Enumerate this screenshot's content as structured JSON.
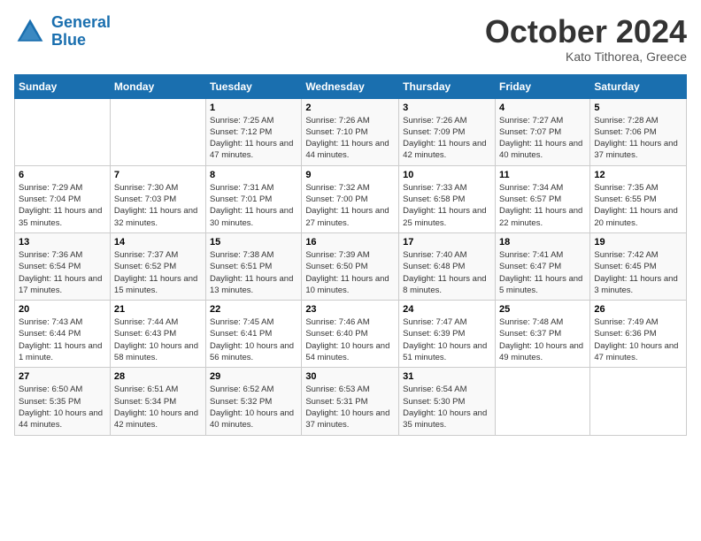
{
  "header": {
    "logo_line1": "General",
    "logo_line2": "Blue",
    "month": "October 2024",
    "location": "Kato Tithorea, Greece"
  },
  "days_of_week": [
    "Sunday",
    "Monday",
    "Tuesday",
    "Wednesday",
    "Thursday",
    "Friday",
    "Saturday"
  ],
  "weeks": [
    [
      {
        "day": "",
        "info": ""
      },
      {
        "day": "",
        "info": ""
      },
      {
        "day": "1",
        "info": "Sunrise: 7:25 AM\nSunset: 7:12 PM\nDaylight: 11 hours and 47 minutes."
      },
      {
        "day": "2",
        "info": "Sunrise: 7:26 AM\nSunset: 7:10 PM\nDaylight: 11 hours and 44 minutes."
      },
      {
        "day": "3",
        "info": "Sunrise: 7:26 AM\nSunset: 7:09 PM\nDaylight: 11 hours and 42 minutes."
      },
      {
        "day": "4",
        "info": "Sunrise: 7:27 AM\nSunset: 7:07 PM\nDaylight: 11 hours and 40 minutes."
      },
      {
        "day": "5",
        "info": "Sunrise: 7:28 AM\nSunset: 7:06 PM\nDaylight: 11 hours and 37 minutes."
      }
    ],
    [
      {
        "day": "6",
        "info": "Sunrise: 7:29 AM\nSunset: 7:04 PM\nDaylight: 11 hours and 35 minutes."
      },
      {
        "day": "7",
        "info": "Sunrise: 7:30 AM\nSunset: 7:03 PM\nDaylight: 11 hours and 32 minutes."
      },
      {
        "day": "8",
        "info": "Sunrise: 7:31 AM\nSunset: 7:01 PM\nDaylight: 11 hours and 30 minutes."
      },
      {
        "day": "9",
        "info": "Sunrise: 7:32 AM\nSunset: 7:00 PM\nDaylight: 11 hours and 27 minutes."
      },
      {
        "day": "10",
        "info": "Sunrise: 7:33 AM\nSunset: 6:58 PM\nDaylight: 11 hours and 25 minutes."
      },
      {
        "day": "11",
        "info": "Sunrise: 7:34 AM\nSunset: 6:57 PM\nDaylight: 11 hours and 22 minutes."
      },
      {
        "day": "12",
        "info": "Sunrise: 7:35 AM\nSunset: 6:55 PM\nDaylight: 11 hours and 20 minutes."
      }
    ],
    [
      {
        "day": "13",
        "info": "Sunrise: 7:36 AM\nSunset: 6:54 PM\nDaylight: 11 hours and 17 minutes."
      },
      {
        "day": "14",
        "info": "Sunrise: 7:37 AM\nSunset: 6:52 PM\nDaylight: 11 hours and 15 minutes."
      },
      {
        "day": "15",
        "info": "Sunrise: 7:38 AM\nSunset: 6:51 PM\nDaylight: 11 hours and 13 minutes."
      },
      {
        "day": "16",
        "info": "Sunrise: 7:39 AM\nSunset: 6:50 PM\nDaylight: 11 hours and 10 minutes."
      },
      {
        "day": "17",
        "info": "Sunrise: 7:40 AM\nSunset: 6:48 PM\nDaylight: 11 hours and 8 minutes."
      },
      {
        "day": "18",
        "info": "Sunrise: 7:41 AM\nSunset: 6:47 PM\nDaylight: 11 hours and 5 minutes."
      },
      {
        "day": "19",
        "info": "Sunrise: 7:42 AM\nSunset: 6:45 PM\nDaylight: 11 hours and 3 minutes."
      }
    ],
    [
      {
        "day": "20",
        "info": "Sunrise: 7:43 AM\nSunset: 6:44 PM\nDaylight: 11 hours and 1 minute."
      },
      {
        "day": "21",
        "info": "Sunrise: 7:44 AM\nSunset: 6:43 PM\nDaylight: 10 hours and 58 minutes."
      },
      {
        "day": "22",
        "info": "Sunrise: 7:45 AM\nSunset: 6:41 PM\nDaylight: 10 hours and 56 minutes."
      },
      {
        "day": "23",
        "info": "Sunrise: 7:46 AM\nSunset: 6:40 PM\nDaylight: 10 hours and 54 minutes."
      },
      {
        "day": "24",
        "info": "Sunrise: 7:47 AM\nSunset: 6:39 PM\nDaylight: 10 hours and 51 minutes."
      },
      {
        "day": "25",
        "info": "Sunrise: 7:48 AM\nSunset: 6:37 PM\nDaylight: 10 hours and 49 minutes."
      },
      {
        "day": "26",
        "info": "Sunrise: 7:49 AM\nSunset: 6:36 PM\nDaylight: 10 hours and 47 minutes."
      }
    ],
    [
      {
        "day": "27",
        "info": "Sunrise: 6:50 AM\nSunset: 5:35 PM\nDaylight: 10 hours and 44 minutes."
      },
      {
        "day": "28",
        "info": "Sunrise: 6:51 AM\nSunset: 5:34 PM\nDaylight: 10 hours and 42 minutes."
      },
      {
        "day": "29",
        "info": "Sunrise: 6:52 AM\nSunset: 5:32 PM\nDaylight: 10 hours and 40 minutes."
      },
      {
        "day": "30",
        "info": "Sunrise: 6:53 AM\nSunset: 5:31 PM\nDaylight: 10 hours and 37 minutes."
      },
      {
        "day": "31",
        "info": "Sunrise: 6:54 AM\nSunset: 5:30 PM\nDaylight: 10 hours and 35 minutes."
      },
      {
        "day": "",
        "info": ""
      },
      {
        "day": "",
        "info": ""
      }
    ]
  ]
}
